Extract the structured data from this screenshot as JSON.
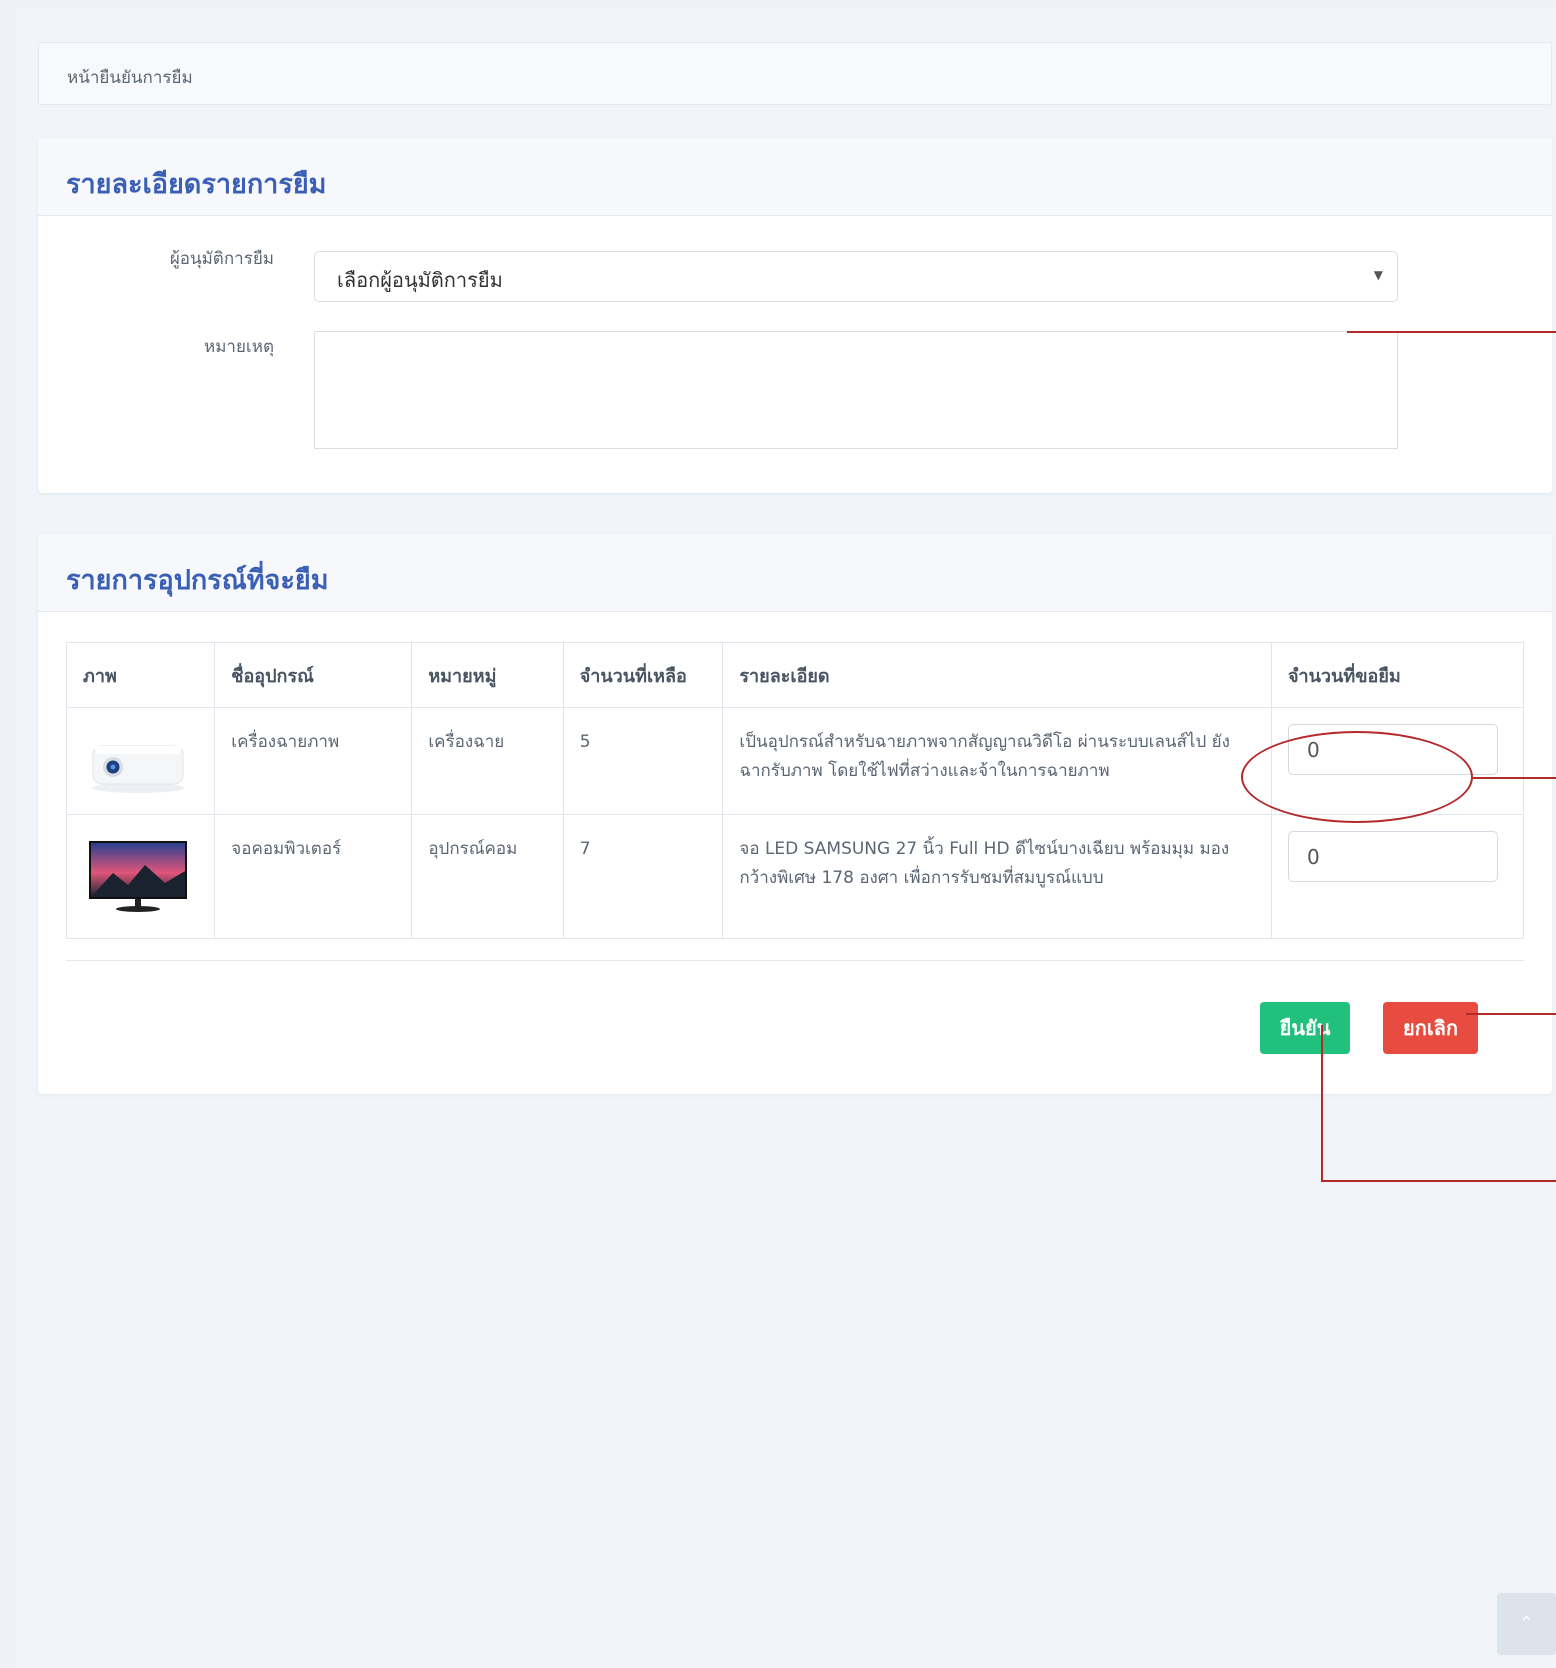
{
  "breadcrumb": "หน้ายืนยันการยืม",
  "details_card": {
    "title": "รายละเอียดรายการยืม",
    "approver_label": "ผู้อนุมัติการยืม",
    "approver_selected": "เลือกผู้อนุมัติการยืม",
    "note_label": "หมายเหตุ",
    "note_value": ""
  },
  "equipment_card": {
    "title": "รายการอุปกรณ์ที่จะยืม",
    "columns": [
      "ภาพ",
      "ชื่ออุปกรณ์",
      "หมายหมู่",
      "จำนวนที่เหลือ",
      "รายละเอียด",
      "จำนวนที่ขอยืม"
    ],
    "rows": [
      {
        "image_icon": "projector-icon",
        "name": "เครื่องฉายภาพ",
        "category": "เครื่องฉาย",
        "remaining": "5",
        "description": "เป็นอุปกรณ์สำหรับฉายภาพจากสัญญาณวิดีโอ ผ่านระบบเลนส์ไป ยังฉากรับภาพ โดยใช้ไฟที่สว่างและจ้าในการฉายภาพ",
        "requested": "0"
      },
      {
        "image_icon": "monitor-icon",
        "name": "จอคอมพิวเตอร์",
        "category": "อุปกรณ์คอม",
        "remaining": "7",
        "description": "จอ LED SAMSUNG 27 นิ้ว Full HD ดีไซน์บางเฉียบ พร้อมมุม มองกว้างพิเศษ 178 องศา เพื่อการรับชมที่สมบูรณ์แบบ",
        "requested": "0"
      }
    ],
    "confirm_label": "ยืนยัน",
    "cancel_label": "ยกเลิก"
  },
  "colors": {
    "title_blue": "#3a5fb5",
    "confirm_green": "#21c07d",
    "cancel_red": "#e84c41",
    "annotation_red": "#b22a2a"
  },
  "scroll_top_icon": "chevron-up-icon"
}
